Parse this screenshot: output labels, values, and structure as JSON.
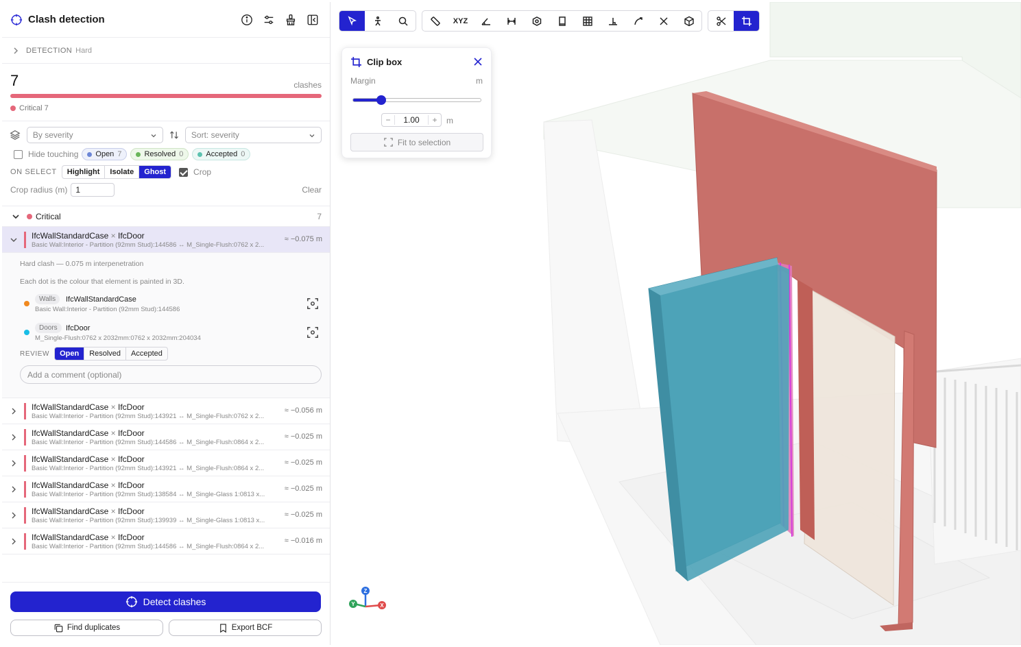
{
  "panel": {
    "title": "Clash detection",
    "detection_label": "DETECTION",
    "detection_level": "Hard",
    "count": "7",
    "count_label": "clashes",
    "legend_label": "Critical 7",
    "critical_fraction": 1.0
  },
  "filters": {
    "group_by": "By severity",
    "sort": "Sort: severity",
    "hide_touching": "Hide touching",
    "open_label": "Open",
    "open_count": "7",
    "resolved_label": "Resolved",
    "resolved_count": "0",
    "accepted_label": "Accepted",
    "accepted_count": "0",
    "on_select": "ON SELECT",
    "modes": [
      "Highlight",
      "Isolate",
      "Ghost"
    ],
    "active_mode": "Ghost",
    "crop_label": "Crop",
    "crop_radius_label": "Crop radius (m)",
    "crop_radius_value": "1",
    "clear_label": "Clear"
  },
  "group": {
    "label": "Critical",
    "count": "7"
  },
  "clashes": [
    {
      "a": "IfcWallStandardCase",
      "b": "IfcDoor",
      "desc": "Basic Wall:Interior - Partition (92mm Stud):144586 ↔ M_Single-Flush:0762 x 2...",
      "dist": "≈ −0.075 m"
    },
    {
      "a": "IfcWallStandardCase",
      "b": "IfcDoor",
      "desc": "Basic Wall:Interior - Partition (92mm Stud):143921 ↔ M_Single-Flush:0762 x 2...",
      "dist": "≈ −0.056 m"
    },
    {
      "a": "IfcWallStandardCase",
      "b": "IfcDoor",
      "desc": "Basic Wall:Interior - Partition (92mm Stud):144586 ↔ M_Single-Flush:0864 x 2...",
      "dist": "≈ −0.025 m"
    },
    {
      "a": "IfcWallStandardCase",
      "b": "IfcDoor",
      "desc": "Basic Wall:Interior - Partition (92mm Stud):143921 ↔ M_Single-Flush:0864 x 2...",
      "dist": "≈ −0.025 m"
    },
    {
      "a": "IfcWallStandardCase",
      "b": "IfcDoor",
      "desc": "Basic Wall:Interior - Partition (92mm Stud):138584 ↔ M_Single-Glass 1:0813 x...",
      "dist": "≈ −0.025 m"
    },
    {
      "a": "IfcWallStandardCase",
      "b": "IfcDoor",
      "desc": "Basic Wall:Interior - Partition (92mm Stud):139939 ↔ M_Single-Glass 1:0813 x...",
      "dist": "≈ −0.025 m"
    },
    {
      "a": "IfcWallStandardCase",
      "b": "IfcDoor",
      "desc": "Basic Wall:Interior - Partition (92mm Stud):144586 ↔ M_Single-Flush:0864 x 2...",
      "dist": "≈ −0.016 m"
    }
  ],
  "detail": {
    "summary": "Hard clash — 0.075 m interpenetration",
    "hint": "Each dot is the colour that element is painted in 3D.",
    "elements": [
      {
        "category": "Walls",
        "name": "IfcWallStandardCase",
        "sub": "Basic Wall:Interior - Partition (92mm Stud):144586",
        "color": "#f0891f"
      },
      {
        "category": "Doors",
        "name": "IfcDoor",
        "sub": "M_Single-Flush:0762 x 2032mm:0762 x 2032mm:204034",
        "color": "#19bde6"
      }
    ],
    "review_label": "REVIEW",
    "review_options": [
      "Open",
      "Resolved",
      "Accepted"
    ],
    "review_active": "Open",
    "comment_placeholder": "Add a comment (optional)"
  },
  "footer": {
    "detect": "Detect clashes",
    "find_duplicates": "Find duplicates",
    "export_bcf": "Export BCF"
  },
  "toolbar": {
    "xyz_label": "XYZ",
    "icons": [
      "select-icon",
      "walk-icon",
      "zoom-icon",
      "measure-icon",
      "coordinates-icon",
      "angle-icon",
      "distance-icon",
      "area-icon",
      "section-icon",
      "grid-icon",
      "perpendicular-icon",
      "path-icon",
      "clear-measure-icon",
      "cube-icon",
      "scissors-icon",
      "clip-box-icon"
    ]
  },
  "clipbox": {
    "title": "Clip box",
    "margin_label": "Margin",
    "unit": "m",
    "margin_value": "1.00",
    "slider_fraction": 0.22,
    "fit_label": "Fit to selection"
  },
  "axes": {
    "z": "Z",
    "y": "Y",
    "x": "X"
  },
  "colors": {
    "accent": "#2323cf",
    "critical": "#e5677a",
    "wall": "#c96a5f",
    "door": "#4aa3b8"
  }
}
